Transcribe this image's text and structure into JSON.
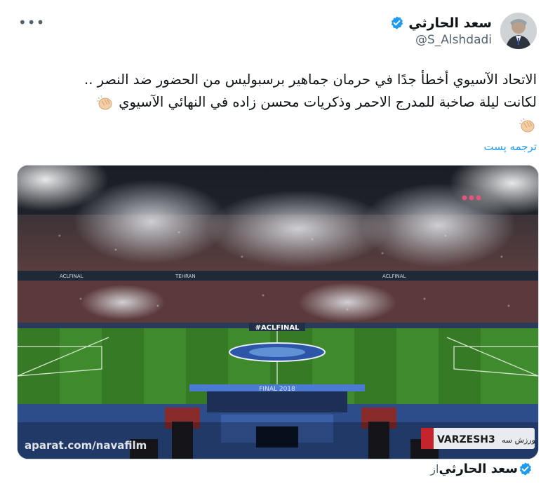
{
  "tweet": {
    "author": {
      "display_name": "سعد الحارثي",
      "handle": "@S_Alshdadi",
      "verified": true
    },
    "more_icon": "more-dots-icon",
    "text_lines": [
      "الاتحاد الآسيوي أخطأ جدًا في حرمان جماهير برسبوليس من الحضور ضد النصر ..",
      "لكانت ليلة صاخبة للمدرج الاحمر وذكريات محسن زاده في النهائي الآسيوي"
    ],
    "translate_label": "ترجمه پست",
    "media": {
      "watermark_left": "aparat.com/navafilm",
      "board_text": "#ACLFINAL",
      "banner_text": "VARZESH3",
      "channel_text": "ورزش سه",
      "bottom_board": "FINAL 2018",
      "stand_labels": [
        "ACLFINAL",
        "TEHRAN",
        "ACLFINAL"
      ]
    },
    "footer": {
      "from_label": "از",
      "display_name": "سعد الحارثي"
    }
  },
  "colors": {
    "accent": "#1d9bf0",
    "secondary_text": "#536471",
    "pitch_green": "#3f8a2c"
  }
}
